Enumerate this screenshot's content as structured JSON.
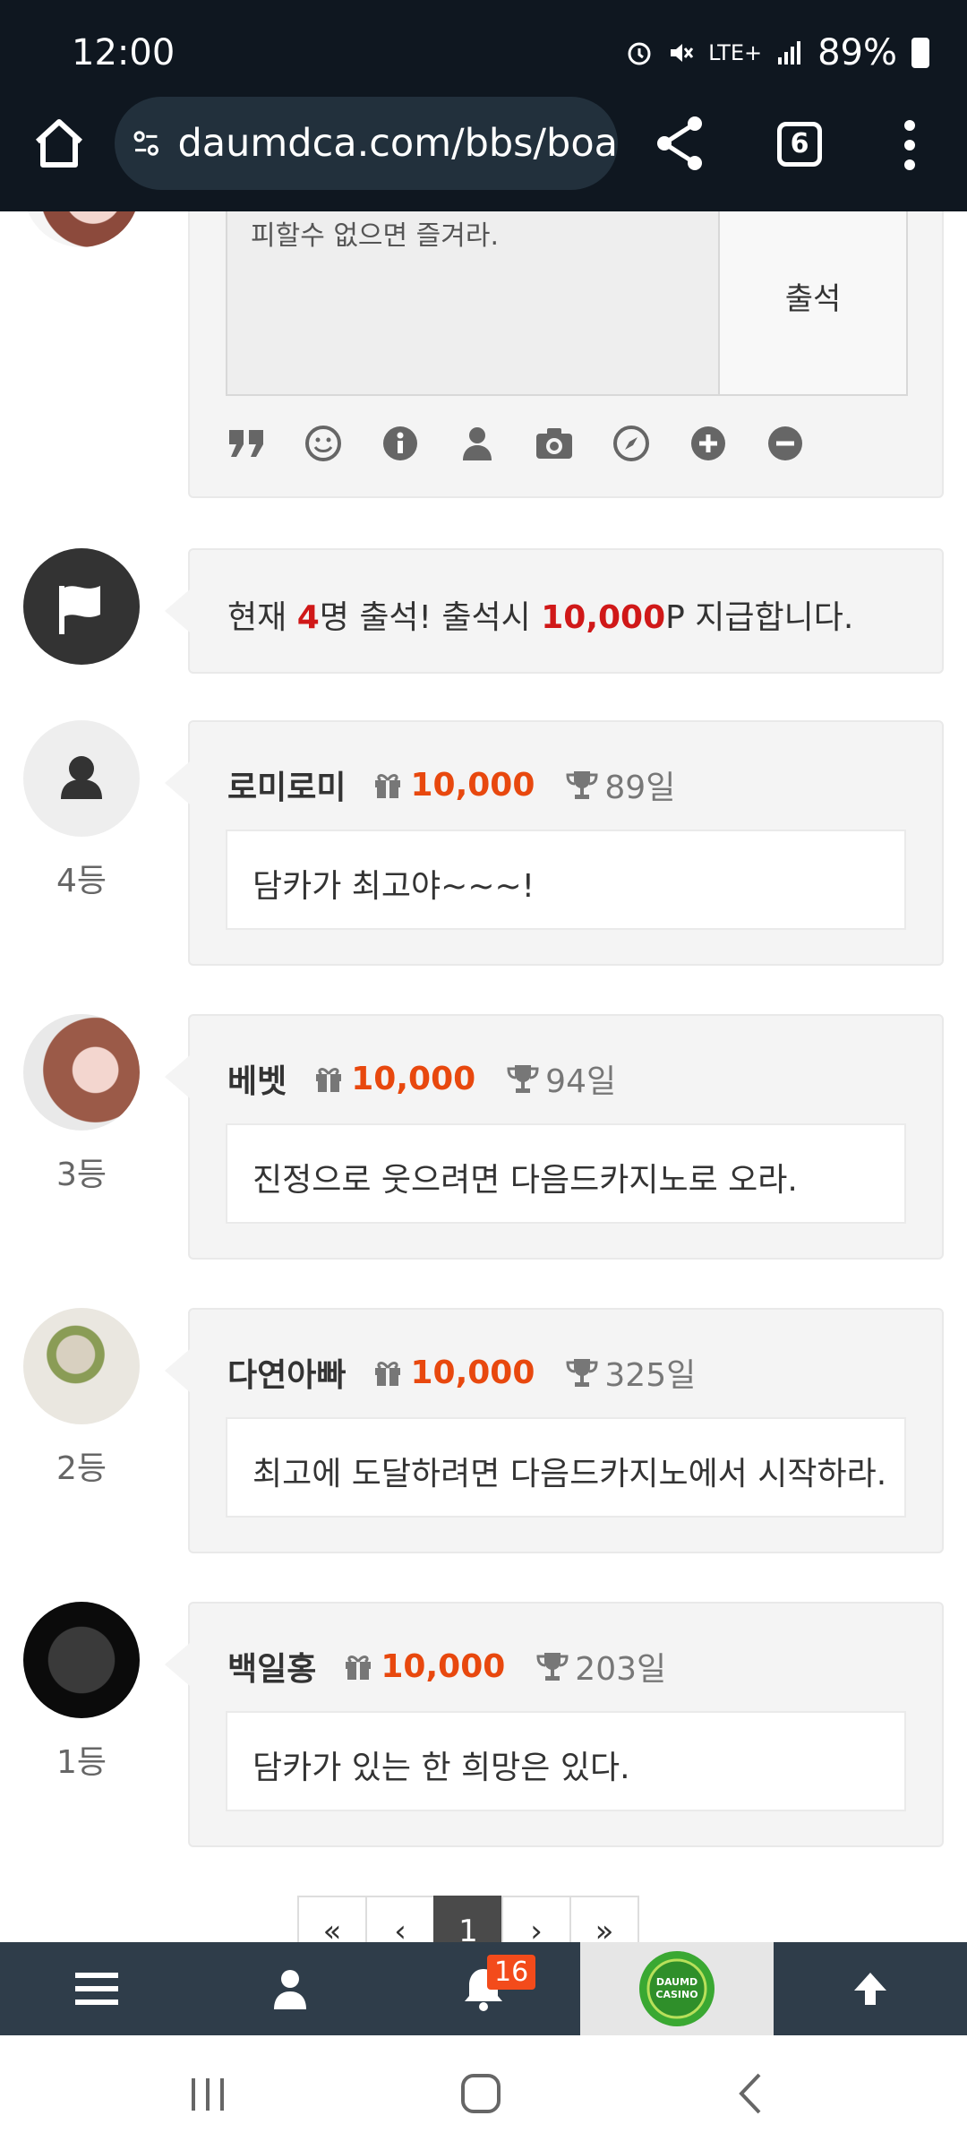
{
  "status_bar": {
    "time": "12:00",
    "network": "LTE+",
    "battery": "89%"
  },
  "browser": {
    "url": "daumdca.com/bbs/boa",
    "tab_count": "6"
  },
  "form": {
    "textarea_value": "피할수 없으면 즐겨라.",
    "submit_label": "출석"
  },
  "notice": {
    "prefix": "현재 ",
    "count": "4",
    "mid": "명 출석! 출석시 ",
    "reward": "10,000",
    "suffix": "P 지급합니다."
  },
  "entries": [
    {
      "rank": "4등",
      "nickname": "로미로미",
      "points": "10,000",
      "days": "89일",
      "message": "담카가 최고야~~~!"
    },
    {
      "rank": "3등",
      "nickname": "베벳",
      "points": "10,000",
      "days": "94일",
      "message": "진정으로 웃으려면 다음드카지노로 오라."
    },
    {
      "rank": "2등",
      "nickname": "다연아빠",
      "points": "10,000",
      "days": "325일",
      "message": "최고에 도달하려면 다음드카지노에서 시작하라."
    },
    {
      "rank": "1등",
      "nickname": "백일홍",
      "points": "10,000",
      "days": "203일",
      "message": "담카가 있는 한 희망은 있다."
    }
  ],
  "pagination": {
    "first": "«",
    "prev": "‹",
    "current": "1",
    "next": "›",
    "last": "»"
  },
  "bottom_bar": {
    "notification_count": "16",
    "logo_text": "DAUMD CASINO"
  },
  "colors": {
    "accent_orange": "#e8480e",
    "notice_red": "#d01818",
    "topbar": "#0f1720",
    "bottom_bar": "#2f3d4a"
  }
}
